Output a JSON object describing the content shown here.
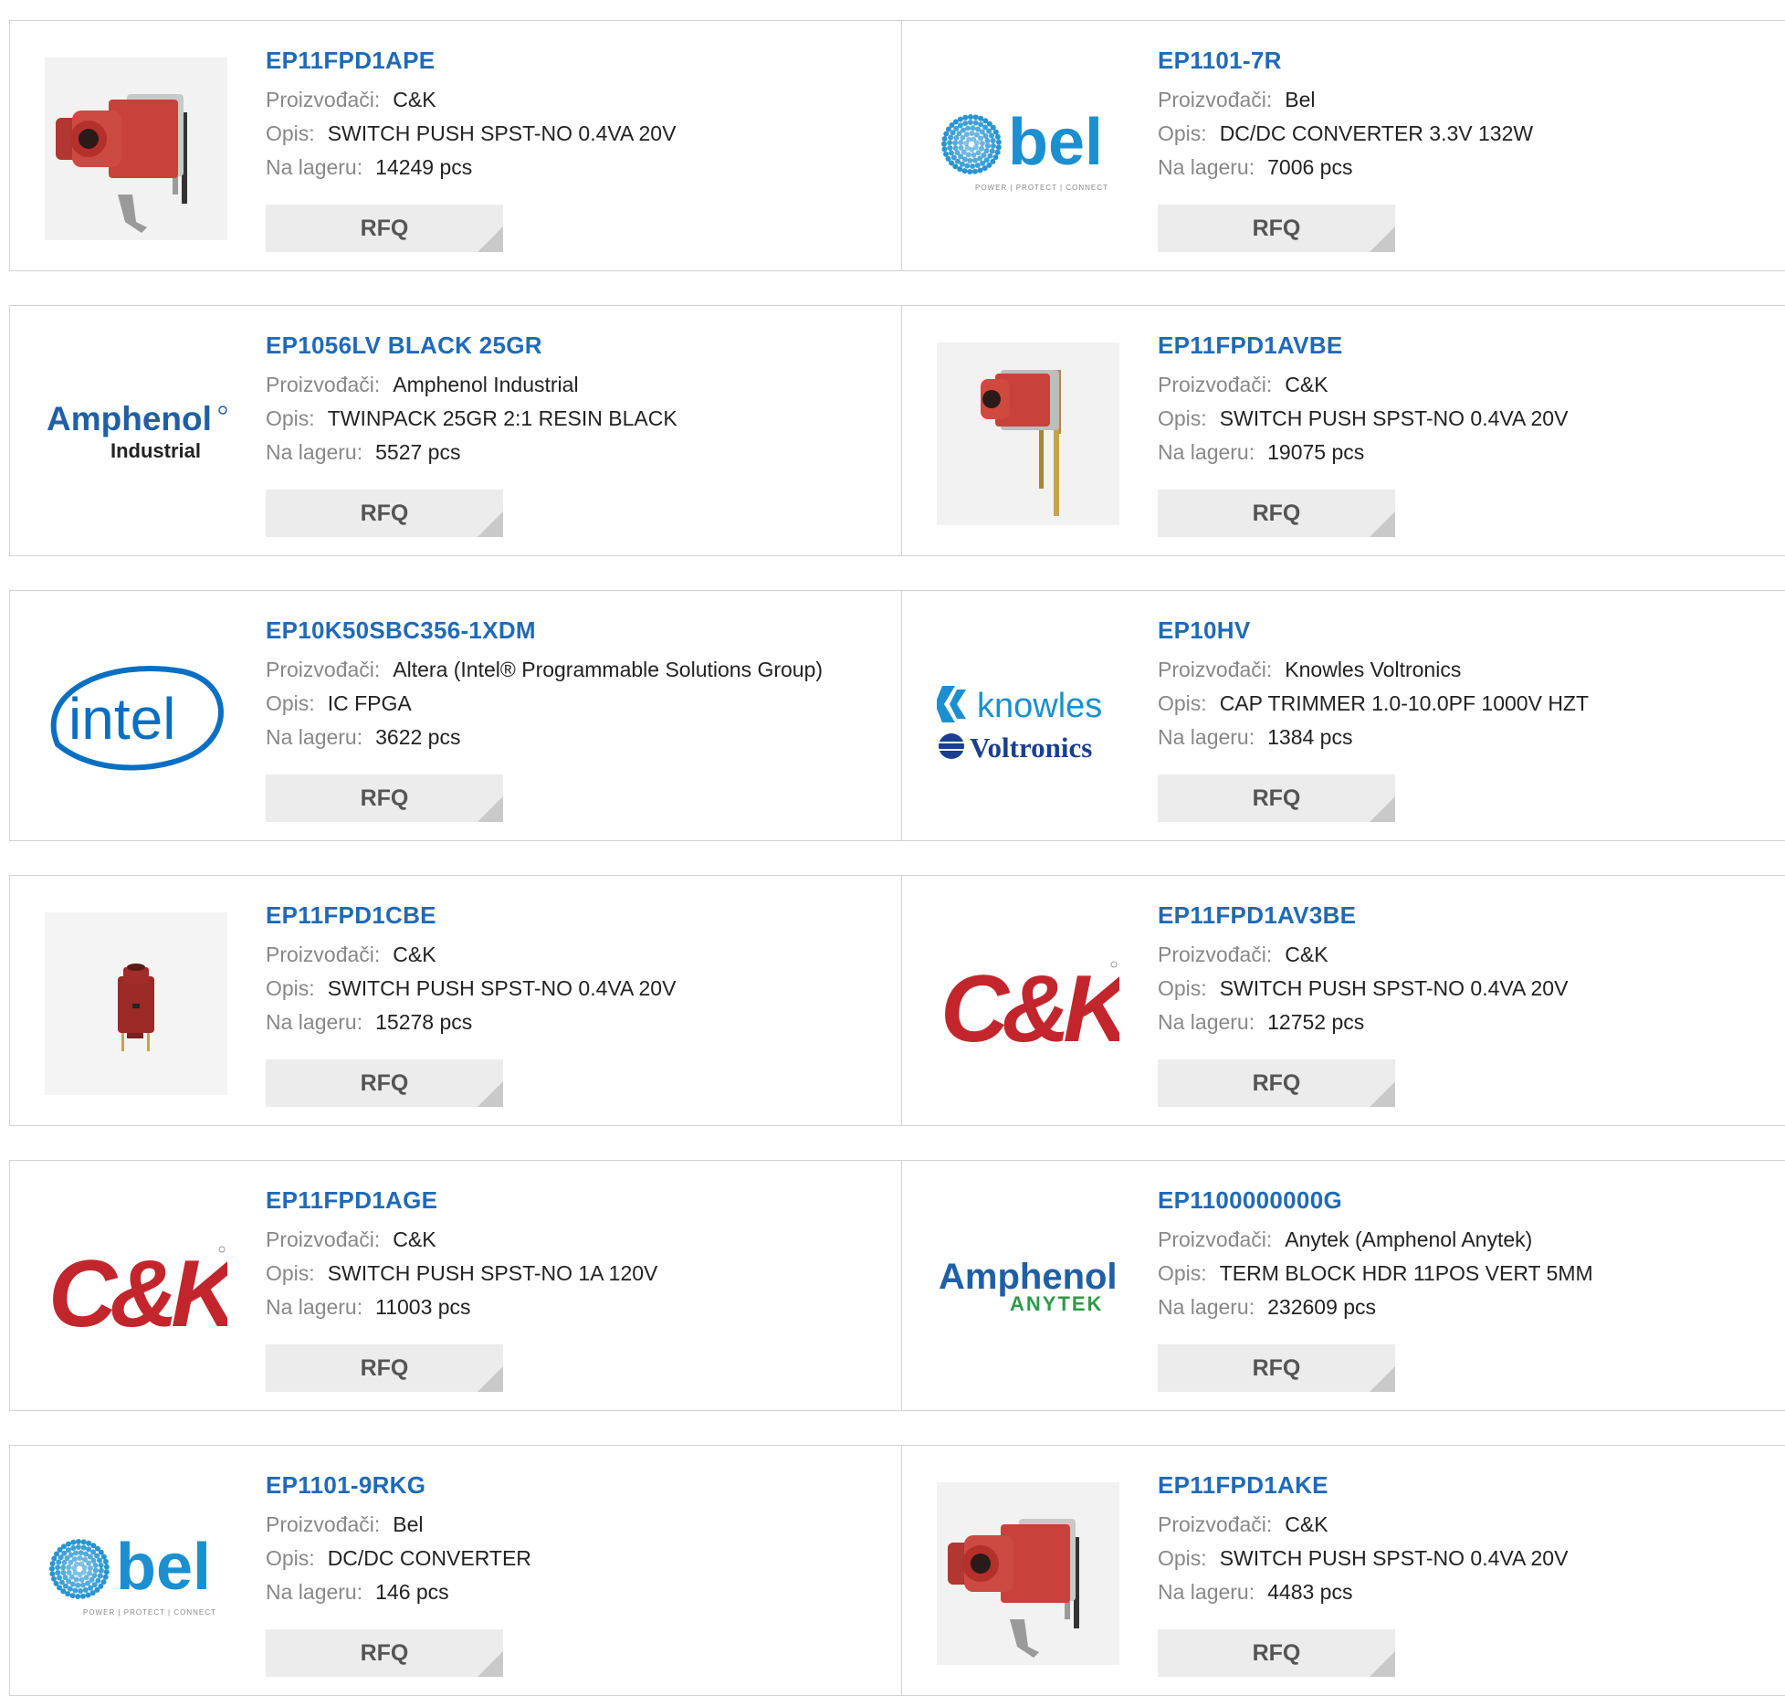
{
  "labels": {
    "manufacturer": "Proizvođači:",
    "description": "Opis:",
    "stock": "Na lageru:",
    "rfq": "RFQ"
  },
  "products": [
    {
      "part": "EP11FPD1APE",
      "manufacturer": "C&K",
      "description": "SWITCH PUSH SPST-NO 0.4VA 20V",
      "stock": "14249 pcs",
      "thumb": "switch-large"
    },
    {
      "part": "EP1101-7R",
      "manufacturer": "Bel",
      "description": "DC/DC CONVERTER 3.3V 132W",
      "stock": "7006 pcs",
      "thumb": "bel"
    },
    {
      "part": "EP1056LV BLACK 25GR",
      "manufacturer": "Amphenol Industrial",
      "description": "TWINPACK 25GR 2:1 RESIN BLACK",
      "stock": "5527 pcs",
      "thumb": "amphenol-industrial"
    },
    {
      "part": "EP11FPD1AVBE",
      "manufacturer": "C&K",
      "description": "SWITCH PUSH SPST-NO 0.4VA 20V",
      "stock": "19075 pcs",
      "thumb": "switch-tall"
    },
    {
      "part": "EP10K50SBC356-1XDM",
      "manufacturer": "Altera (Intel® Programmable Solutions Group)",
      "description": "IC FPGA",
      "stock": "3622 pcs",
      "thumb": "intel"
    },
    {
      "part": "EP10HV",
      "manufacturer": "Knowles Voltronics",
      "description": "CAP TRIMMER 1.0-10.0PF 1000V HZT",
      "stock": "1384 pcs",
      "thumb": "knowles"
    },
    {
      "part": "EP11FPD1CBE",
      "manufacturer": "C&K",
      "description": "SWITCH PUSH SPST-NO 0.4VA 20V",
      "stock": "15278 pcs",
      "thumb": "switch-small"
    },
    {
      "part": "EP11FPD1AV3BE",
      "manufacturer": "C&K",
      "description": "SWITCH PUSH SPST-NO 0.4VA 20V",
      "stock": "12752 pcs",
      "thumb": "ck"
    },
    {
      "part": "EP11FPD1AGE",
      "manufacturer": "C&K",
      "description": "SWITCH PUSH SPST-NO 1A 120V",
      "stock": "11003 pcs",
      "thumb": "ck"
    },
    {
      "part": "EP1100000000G",
      "manufacturer": "Anytek (Amphenol Anytek)",
      "description": "TERM BLOCK HDR 11POS VERT 5MM",
      "stock": "232609 pcs",
      "thumb": "amphenol-anytek"
    },
    {
      "part": "EP1101-9RKG",
      "manufacturer": "Bel",
      "description": "DC/DC CONVERTER",
      "stock": "146 pcs",
      "thumb": "bel"
    },
    {
      "part": "EP11FPD1AKE",
      "manufacturer": "C&K",
      "description": "SWITCH PUSH SPST-NO 0.4VA 20V",
      "stock": "4483 pcs",
      "thumb": "switch-large"
    }
  ],
  "logos": {
    "bel": {
      "word": "bel",
      "tagline": "POWER | PROTECT | CONNECT",
      "color": "#1b8fd0"
    },
    "amphenol": {
      "word": "Amphenol",
      "sub_industrial": "Industrial",
      "sub_anytek": "ANYTEK",
      "color": "#1f5fa6",
      "anytek_color": "#2e9a48"
    },
    "intel": {
      "word": "intel",
      "color": "#0a6fc2"
    },
    "knowles": {
      "word1": "knowles",
      "word2": "Voltronics",
      "color": "#1b8fd0",
      "color2": "#1a3f8f"
    },
    "ck": {
      "word": "C&K",
      "color": "#c2262c"
    }
  }
}
